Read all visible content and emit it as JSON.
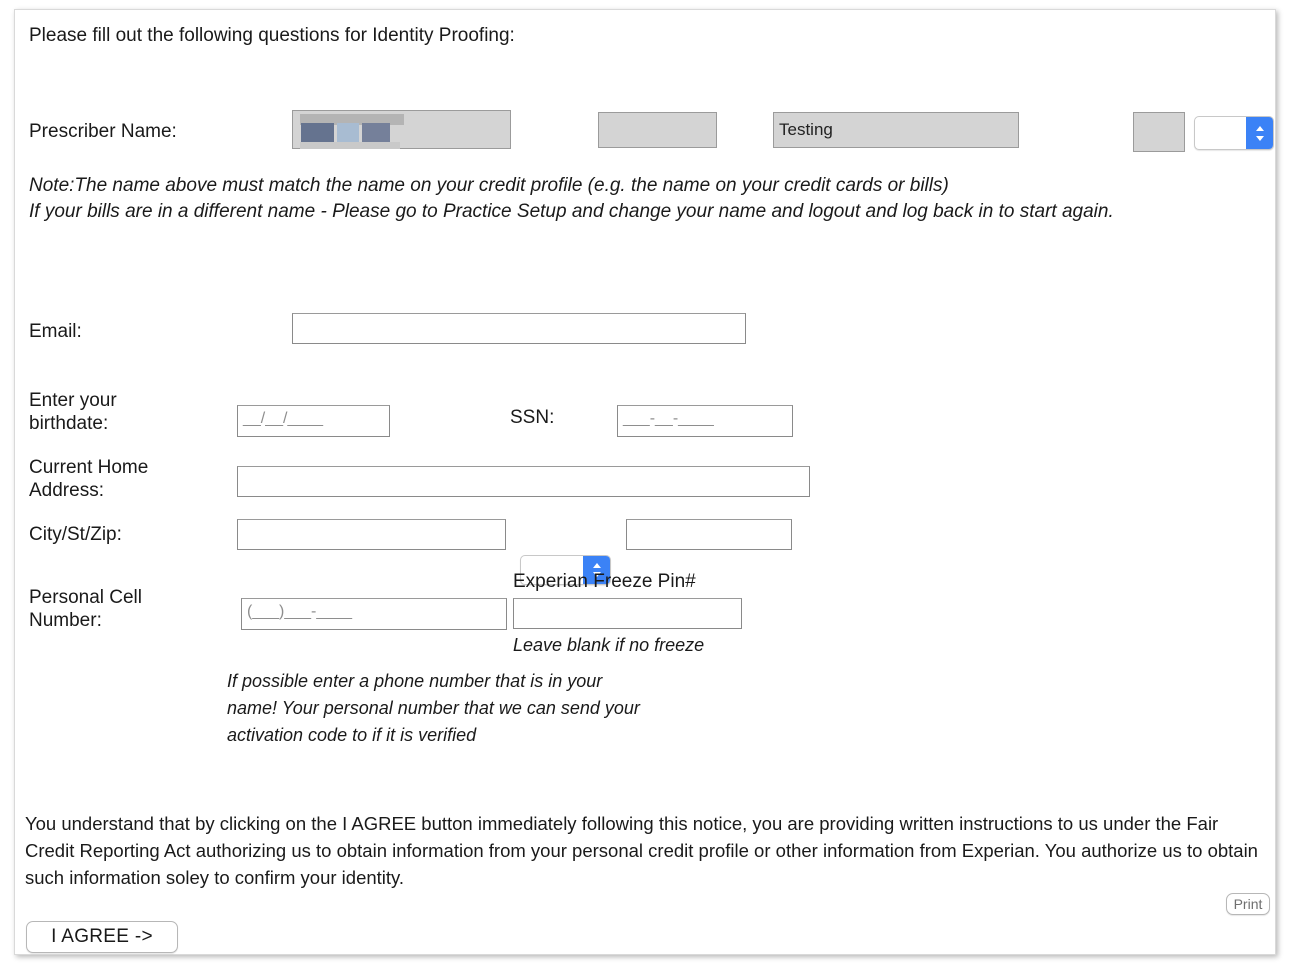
{
  "form": {
    "heading": "Please fill out the following questions for Identity Proofing:",
    "prescriber": {
      "label": "Prescriber Name:",
      "first_value": "",
      "middle_value": "",
      "last_value": "Testing",
      "suffix_value": "",
      "credential_value": ""
    },
    "note": "Note:The name above must match the name on your credit profile (e.g. the name on your credit cards or bills)\nIf your bills are in a different name - Please go to Practice Setup and change your name and logout and log back in to start again.",
    "email": {
      "label": "Email:",
      "value": ""
    },
    "birthdate": {
      "label": "Enter your\nbirthdate:",
      "value": "__/__/____"
    },
    "ssn": {
      "label": "SSN:",
      "value": "___-__-____"
    },
    "address": {
      "label": "Current Home\nAddress:",
      "value": ""
    },
    "citystzip": {
      "label": "City/St/Zip:",
      "city_value": "",
      "state_value": "",
      "zip_value": ""
    },
    "cell": {
      "label": "Personal Cell\nNumber:",
      "value": "(___)___-____"
    },
    "freeze_pin": {
      "label": "Experian Freeze Pin#",
      "value": "",
      "hint": "Leave blank if no freeze"
    },
    "phone_hint": "If possible enter a phone number that is in your\nname! Your personal number that we can send your\nactivation code to if it is verified",
    "disclaimer": "You understand that by clicking on the I AGREE button immediately following this notice, you are providing written instructions to us under the Fair Credit Reporting Act authorizing us to obtain information from your personal credit profile or other information from Experian. You authorize us to obtain such information soley to confirm your identity.",
    "agree_button": "I AGREE ->",
    "print_button": "Print"
  },
  "colors": {
    "accent_blue": "#3b82f6",
    "readonly_field": "#d4d4d4",
    "text": "#1a1a1a"
  }
}
